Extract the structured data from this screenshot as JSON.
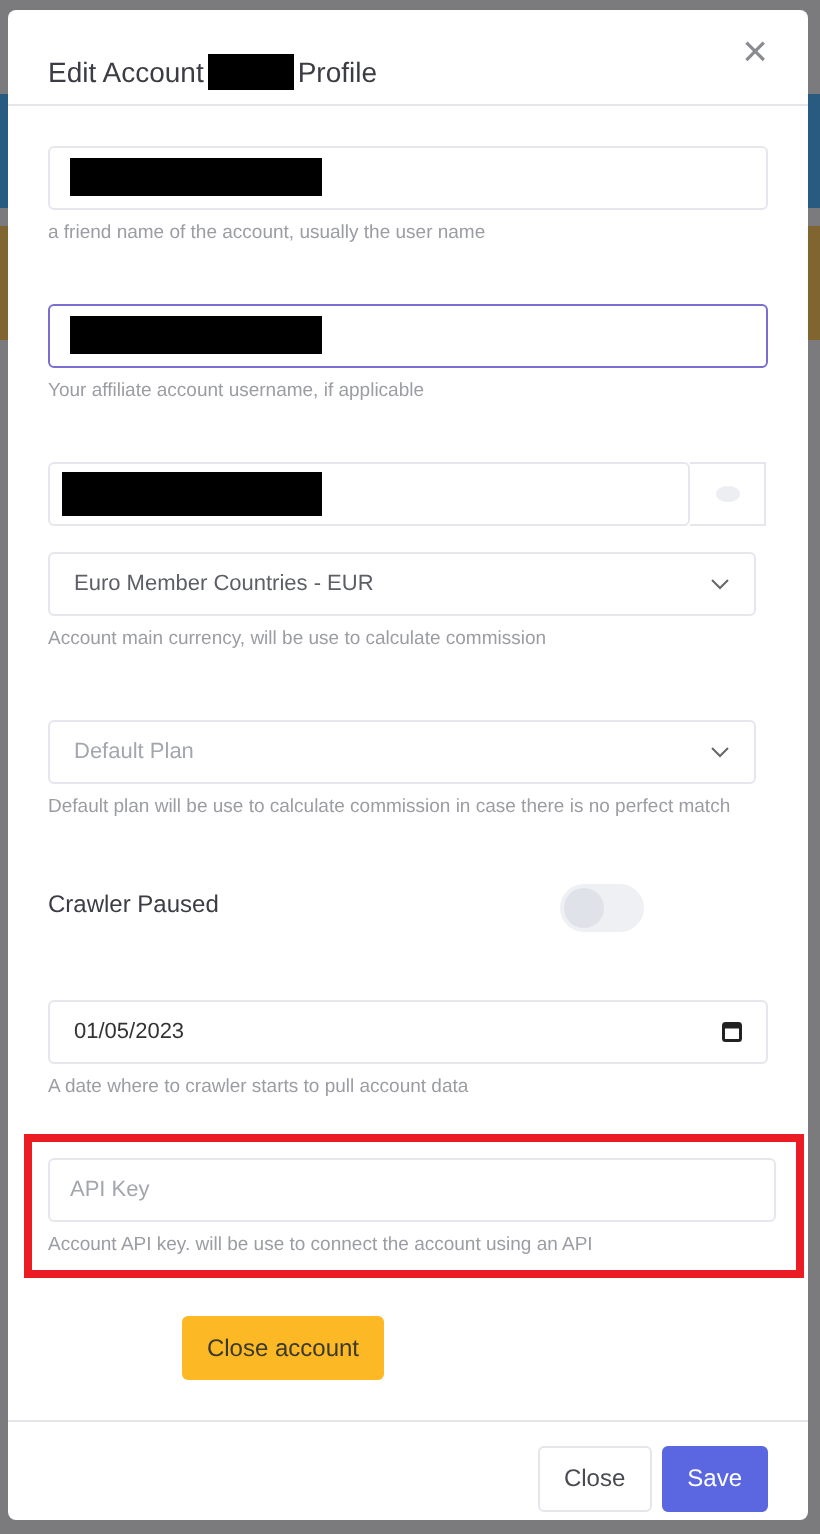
{
  "modal": {
    "title_start": "Edit Account",
    "title_redacted": true,
    "title_end": "Profile",
    "close_icon": "×"
  },
  "fields": [
    {
      "kind": "text",
      "redacted": true,
      "focused": false,
      "help": "a friend name of the account, usually the user name"
    },
    {
      "kind": "text",
      "redacted": true,
      "focused": true,
      "help": "Your affiliate account username, if applicable"
    },
    {
      "kind": "password",
      "redacted": true,
      "focused": false
    },
    {
      "kind": "select",
      "value": "Euro Member Countries - EUR",
      "help": "Account main currency, will be use to calculate commission"
    },
    {
      "kind": "select",
      "placeholder": "Default Plan",
      "help": "Default plan will be use to calculate commission in case there is no perfect match"
    },
    {
      "kind": "toggle",
      "label": "Crawler Paused",
      "on": false
    },
    {
      "kind": "date",
      "value": "01/05/2023",
      "help": "A date where to crawler starts to pull account data"
    },
    {
      "kind": "text",
      "placeholder": "API Key",
      "focused": false,
      "highlighted": true,
      "help": "Account API key. will be use to connect the account using an API"
    }
  ],
  "close_account_button": "Close account",
  "footer": {
    "buttons": [
      {
        "label": "Close",
        "kind": "secondary"
      },
      {
        "label": "Save",
        "kind": "primary"
      }
    ]
  }
}
